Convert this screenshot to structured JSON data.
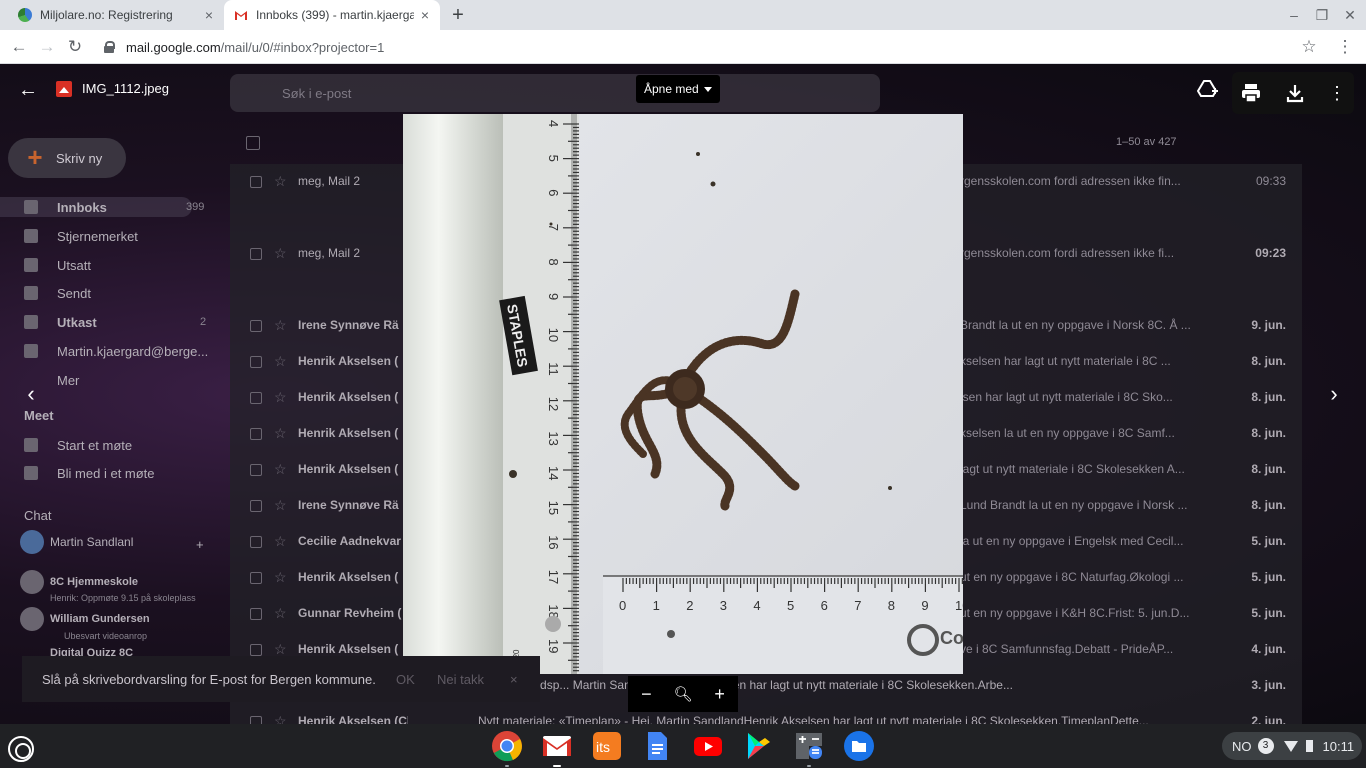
{
  "browser": {
    "tabs": [
      {
        "title": "Miljolare.no: Registrering",
        "active": false
      },
      {
        "title": "Innboks (399) - martin.kjaergard",
        "active": true
      }
    ],
    "url_host": "mail.google.com",
    "url_path": "/mail/u/0/#inbox?projector=1"
  },
  "gmail_bg": {
    "compose_label": "Skriv ny",
    "search_placeholder": "Søk i e-post",
    "nav": [
      {
        "label": "Innboks",
        "count": "399"
      },
      {
        "label": "Stjernemerket",
        "count": ""
      },
      {
        "label": "Utsatt",
        "count": ""
      },
      {
        "label": "Sendt",
        "count": ""
      },
      {
        "label": "Utkast",
        "count": "2"
      },
      {
        "label": "Martin.kjaergard@berge...",
        "count": ""
      },
      {
        "label": "Mer",
        "count": ""
      }
    ],
    "meet_title": "Meet",
    "meet_items": [
      "Start et møte",
      "Bli med i et møte"
    ],
    "chat_title": "Chat",
    "chat_user": "Martin Sandlanl",
    "chat_items": [
      {
        "name": "8C Hjemmeskole",
        "sub": "Henrik: Oppmøte 9.15 på skoleplass"
      },
      {
        "name": "William Gundersen",
        "sub": "Ubesvart videoanrop"
      },
      {
        "name": "Digital Quizz 8C",
        "sub": ""
      }
    ],
    "pager": "1–50 av 427",
    "rows": [
      {
        "sender": "meg, Mail 2",
        "snip": "rgensskolen.com fordi adressen ikke fin...",
        "date": "09:33",
        "bold": false
      },
      {
        "sender": "meg, Mail 2",
        "snip": "rgensskolen.com fordi adressen ikke fi...",
        "date": "09:23",
        "bold": false
      },
      {
        "sender": "Irene Synnøve Rä",
        "snip": "Brandt la ut en ny oppgave i Norsk 8C. Å ...",
        "date": "9. jun.",
        "bold": true
      },
      {
        "sender": "Henrik Akselsen (",
        "snip": "kselsen har lagt ut nytt materiale i 8C ...",
        "date": "8. jun.",
        "bold": true
      },
      {
        "sender": "Henrik Akselsen (",
        "snip": "lsen har lagt ut nytt materiale i 8C Sko...",
        "date": "8. jun.",
        "bold": true
      },
      {
        "sender": "Henrik Akselsen (",
        "snip": "kselsen la ut en ny oppgave i 8C Samf...",
        "date": "8. jun.",
        "bold": true
      },
      {
        "sender": "Henrik Akselsen (",
        "snip": "lagt ut nytt materiale i 8C Skolesekken A...",
        "date": "8. jun.",
        "bold": true
      },
      {
        "sender": "Irene Synnøve Rä",
        "snip": "Lund Brandt la ut en ny oppgave i Norsk ...",
        "date": "8. jun.",
        "bold": true
      },
      {
        "sender": "Cecilie Aadnekvar",
        "snip": "la ut en ny oppgave i Engelsk med Cecil...",
        "date": "5. jun.",
        "bold": true
      },
      {
        "sender": "Henrik Akselsen (",
        "snip": "ut en ny oppgave i 8C Naturfag.Økologi ...",
        "date": "5. jun.",
        "bold": true
      },
      {
        "sender": "Gunnar Revheim (",
        "snip": "ut en ny oppgave i K&H 8C.Frist: 5. jun.D...",
        "date": "5. jun.",
        "bold": true
      },
      {
        "sender": "Henrik Akselsen (",
        "snip": "ve i 8C Samfunnsfag.Debatt - PrideÅP...",
        "date": "4. jun.",
        "bold": true
      },
      {
        "sender": "",
        "snip": "iale: «Arbeidsp... Martin SandlandHenrik Akselsen har lagt ut nytt materiale i 8C Skolesekken.Arbe...",
        "date": "3. jun.",
        "bold": true
      },
      {
        "sender": "Henrik Akselsen (Cl",
        "snip": "Nytt materiale: «Timeplan» - Hei, Martin SandlandHenrik Akselsen har lagt ut nytt materiale i 8C Skolesekken.TimeplanDette...",
        "date": "2. jun.",
        "bold": true
      }
    ]
  },
  "viewer": {
    "filename": "IMG_1112.jpeg",
    "open_with": "Åpne med",
    "photo_ruler_brand": "STAPLES",
    "photo_ruler_code": "746 20",
    "photo_logo": "Co Ex"
  },
  "snackbar": {
    "text": "Slå på skrivebordvarsling for E-post for Bergen kommune.",
    "ok": "OK",
    "no": "Nei takk",
    "close": "×"
  },
  "shelf": {
    "apps": [
      "chrome-icon",
      "gmail-icon",
      "its-icon",
      "docs-icon",
      "youtube-icon",
      "play-store-icon",
      "calculator-icon",
      "files-icon"
    ],
    "locale": "NO",
    "notif_count": "3",
    "time": "10:11"
  }
}
